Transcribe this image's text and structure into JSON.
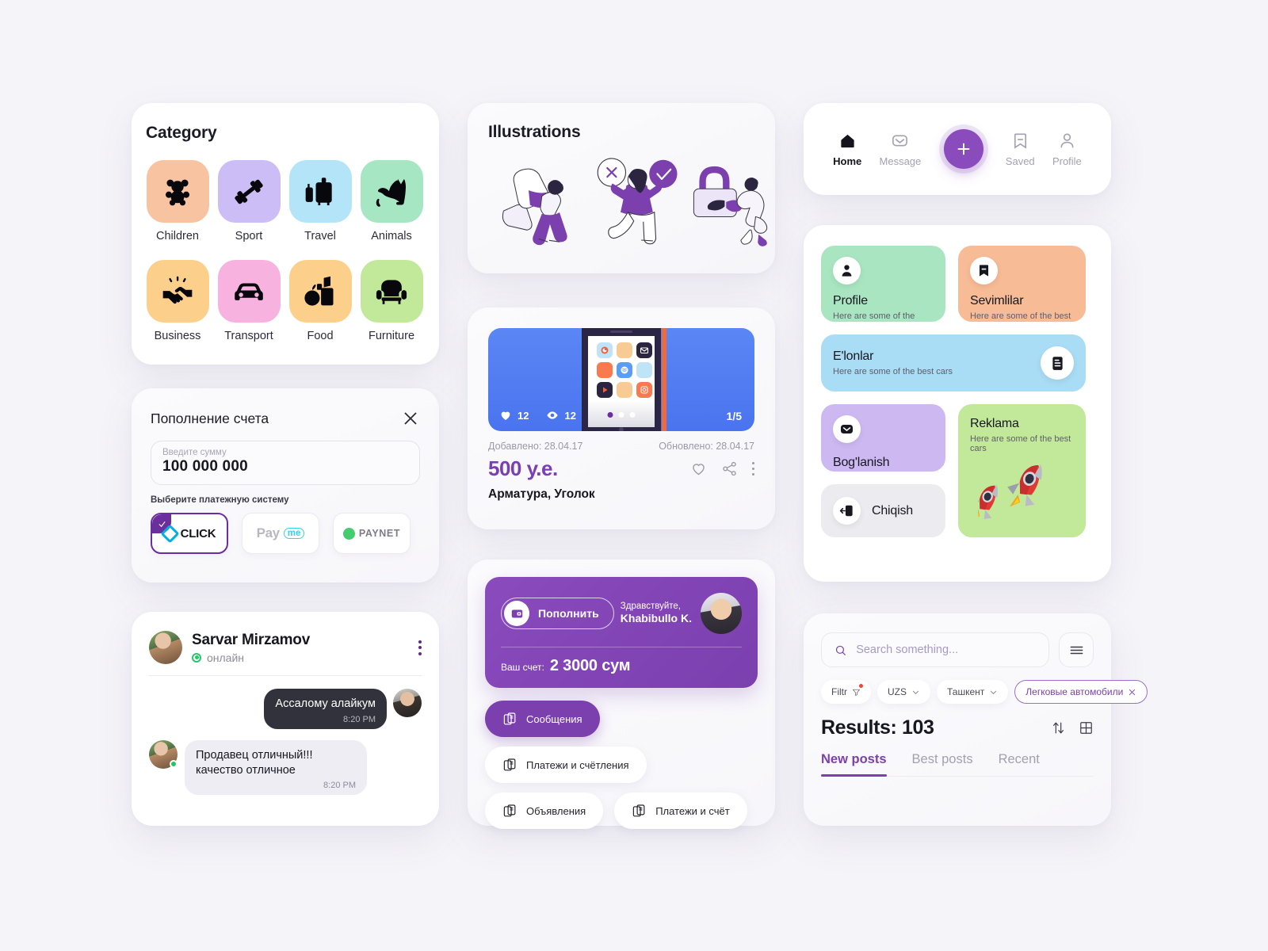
{
  "category": {
    "title": "Category",
    "items": [
      {
        "label": "Children",
        "icon": "teddy-bear-icon",
        "color": "#f8c3a1"
      },
      {
        "label": "Sport",
        "icon": "dumbbell-icon",
        "color": "#cdbdf6"
      },
      {
        "label": "Travel",
        "icon": "luggage-icon",
        "color": "#b3e4f7"
      },
      {
        "label": "Animals",
        "icon": "cat-icon",
        "color": "#a6e6c3"
      },
      {
        "label": "Business",
        "icon": "handshake-icon",
        "color": "#fcd08a"
      },
      {
        "label": "Transport",
        "icon": "car-icon",
        "color": "#f8b2e0"
      },
      {
        "label": "Food",
        "icon": "groceries-icon",
        "color": "#fcd08a"
      },
      {
        "label": "Furniture",
        "icon": "armchair-icon",
        "color": "#c2e89a"
      }
    ]
  },
  "topup": {
    "title": "Пополнение счета",
    "close_icon": "close-icon",
    "amount_label": "Введите сумму",
    "amount_value": "100 000 000",
    "amount_placeholder": "Введите сумму",
    "systems_hint": "Выберите платежную систему",
    "systems": [
      {
        "name": "CLICK",
        "selected": true
      },
      {
        "name": "Payme",
        "selected": false
      },
      {
        "name": "PAYNET",
        "selected": false
      }
    ],
    "payme_main": "Pay",
    "payme_pill": "me",
    "paynet_text": "PAYNET"
  },
  "chat": {
    "name": "Sarvar Mirzamov",
    "status": "онлайн",
    "messages": [
      {
        "text": "Ассалому алайкум",
        "time": "8:20 PM",
        "outgoing": true
      },
      {
        "text": "Продавец отличный!!! качество отличное",
        "time": "8:20 PM",
        "outgoing": false
      }
    ]
  },
  "illustrations": {
    "title": "Illustrations"
  },
  "listing": {
    "likes": "12",
    "views": "12",
    "photo_count": "1/5",
    "added_label": "Добавлено: 28.04.17",
    "updated_label": "Обновлено: 28.04.17",
    "price": "500 у.е.",
    "title": "Арматура, Уголок"
  },
  "wallet": {
    "topup_button": "Пополнить",
    "greeting": "Здравствуйте,",
    "user": "Khabibullo K.",
    "balance_label": "Ваш счет:",
    "balance_value": "2 3000 сум",
    "buttons": [
      {
        "label": "Сообщения",
        "active": true
      },
      {
        "label": "Платежи и счётления",
        "active": false
      },
      {
        "label": "Объявления",
        "active": false
      },
      {
        "label": "Платежи и счёт",
        "active": false
      }
    ]
  },
  "navbar": {
    "items": [
      {
        "label": "Home",
        "icon": "home-icon",
        "active": true
      },
      {
        "label": "Message",
        "icon": "envelope-icon",
        "active": false
      },
      {
        "label": "Saved",
        "icon": "bookmark-icon",
        "active": false
      },
      {
        "label": "Profile",
        "icon": "person-icon",
        "active": false
      }
    ],
    "fab_icon": "plus-icon"
  },
  "menu": {
    "tiles": [
      {
        "title": "Profile",
        "subtitle": "Here are some of the best cars",
        "icon": "person-icon",
        "color": "#a8e5c0"
      },
      {
        "title": "Sevimlilar",
        "subtitle": "Here are some of the best cars",
        "icon": "bookmark-icon",
        "color": "#f7bb95"
      },
      {
        "title": "E'lonlar",
        "subtitle": "Here are some of the best cars",
        "icon": "document-icon",
        "color": "#a9dcf5"
      },
      {
        "title": "Bog'lanish",
        "subtitle": "",
        "icon": "envelope-icon",
        "color": "#cdb8f2"
      },
      {
        "title": "Chiqish",
        "subtitle": "",
        "icon": "logout-icon",
        "color": "#ececf0"
      },
      {
        "title": "Reklama",
        "subtitle": "Here are some of the best cars",
        "icon": "rocket-icon",
        "color": "#c2e89a"
      }
    ]
  },
  "search": {
    "placeholder": "Search something...",
    "value": "",
    "menu_icon": "hamburger-icon",
    "chips": [
      {
        "label": "Filtr",
        "icon": "funnel-icon",
        "accent": false,
        "badge": true
      },
      {
        "label": "UZS",
        "icon": "chevron-down-icon",
        "accent": false,
        "badge": false
      },
      {
        "label": "Ташкент",
        "icon": "chevron-down-icon",
        "accent": false,
        "badge": false
      },
      {
        "label": "Легковые автомобили",
        "icon": "close-icon",
        "accent": true,
        "badge": false
      }
    ],
    "results": "Results: 103",
    "sort_icon": "sort-arrows-icon",
    "grid_icon": "grid-view-icon",
    "tabs": [
      {
        "label": "New posts",
        "active": true
      },
      {
        "label": "Best posts",
        "active": false
      },
      {
        "label": "Recent",
        "active": false
      }
    ]
  },
  "colors": {
    "accent": "#7b3fae",
    "background": "#f5f4f8"
  }
}
